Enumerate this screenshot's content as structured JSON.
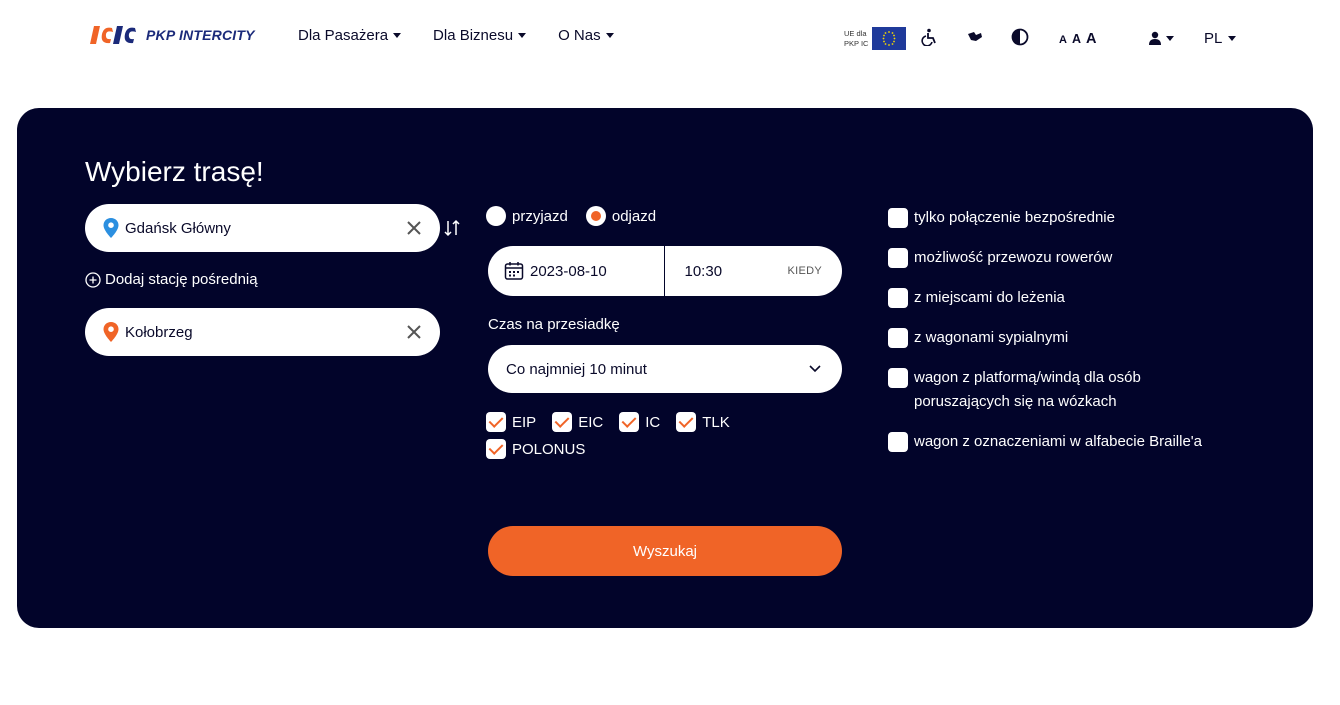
{
  "header": {
    "logo_text": "PKP INTERCITY",
    "nav": [
      "Dla Pasażera",
      "Dla Biznesu",
      "O Nas"
    ],
    "eu_line1": "UE dla",
    "eu_line2": "PKP IC",
    "font_sizes": [
      "A",
      "A",
      "A"
    ],
    "lang": "PL"
  },
  "search": {
    "title": "Wybierz trasę!",
    "from_station": "Gdańsk Główny",
    "add_via": "Dodaj stację pośrednią",
    "to_station": "Kołobrzeg",
    "radio_arrival": "przyjazd",
    "radio_departure": "odjazd",
    "selected_radio": "odjazd",
    "date": "2023-08-10",
    "time": "10:30",
    "when_label": "KIEDY",
    "transfer_label": "Czas na przesiadkę",
    "transfer_value": "Co najmniej 10 minut",
    "trains": [
      {
        "label": "EIP",
        "checked": true
      },
      {
        "label": "EIC",
        "checked": true
      },
      {
        "label": "IC",
        "checked": true
      },
      {
        "label": "TLK",
        "checked": true
      },
      {
        "label": "POLONUS",
        "checked": true
      }
    ],
    "search_button": "Wyszukaj",
    "options": [
      {
        "label": "tylko połączenie bezpośrednie",
        "checked": false
      },
      {
        "label": "możliwość przewozu rowerów",
        "checked": false
      },
      {
        "label": "z miejscami do leżenia",
        "checked": false
      },
      {
        "label": "z wagonami sypialnymi",
        "checked": false
      },
      {
        "label": "wagon z platformą/windą dla osób poruszających się na wózkach",
        "checked": false
      },
      {
        "label": "wagon z oznaczeniami w alfabecie Braille'a",
        "checked": false
      }
    ]
  },
  "colors": {
    "panel_bg": "#02042a",
    "accent": "#f06427",
    "from_pin": "#2b8fe0",
    "to_pin": "#f06427"
  },
  "icons": {
    "accessibility": "wheelchair-icon",
    "sign_language": "sign-language-icon",
    "contrast": "contrast-icon",
    "user": "user-icon",
    "calendar": "calendar-icon",
    "swap": "swap-stations-icon",
    "clear": "close-icon",
    "pin": "location-pin-icon"
  }
}
